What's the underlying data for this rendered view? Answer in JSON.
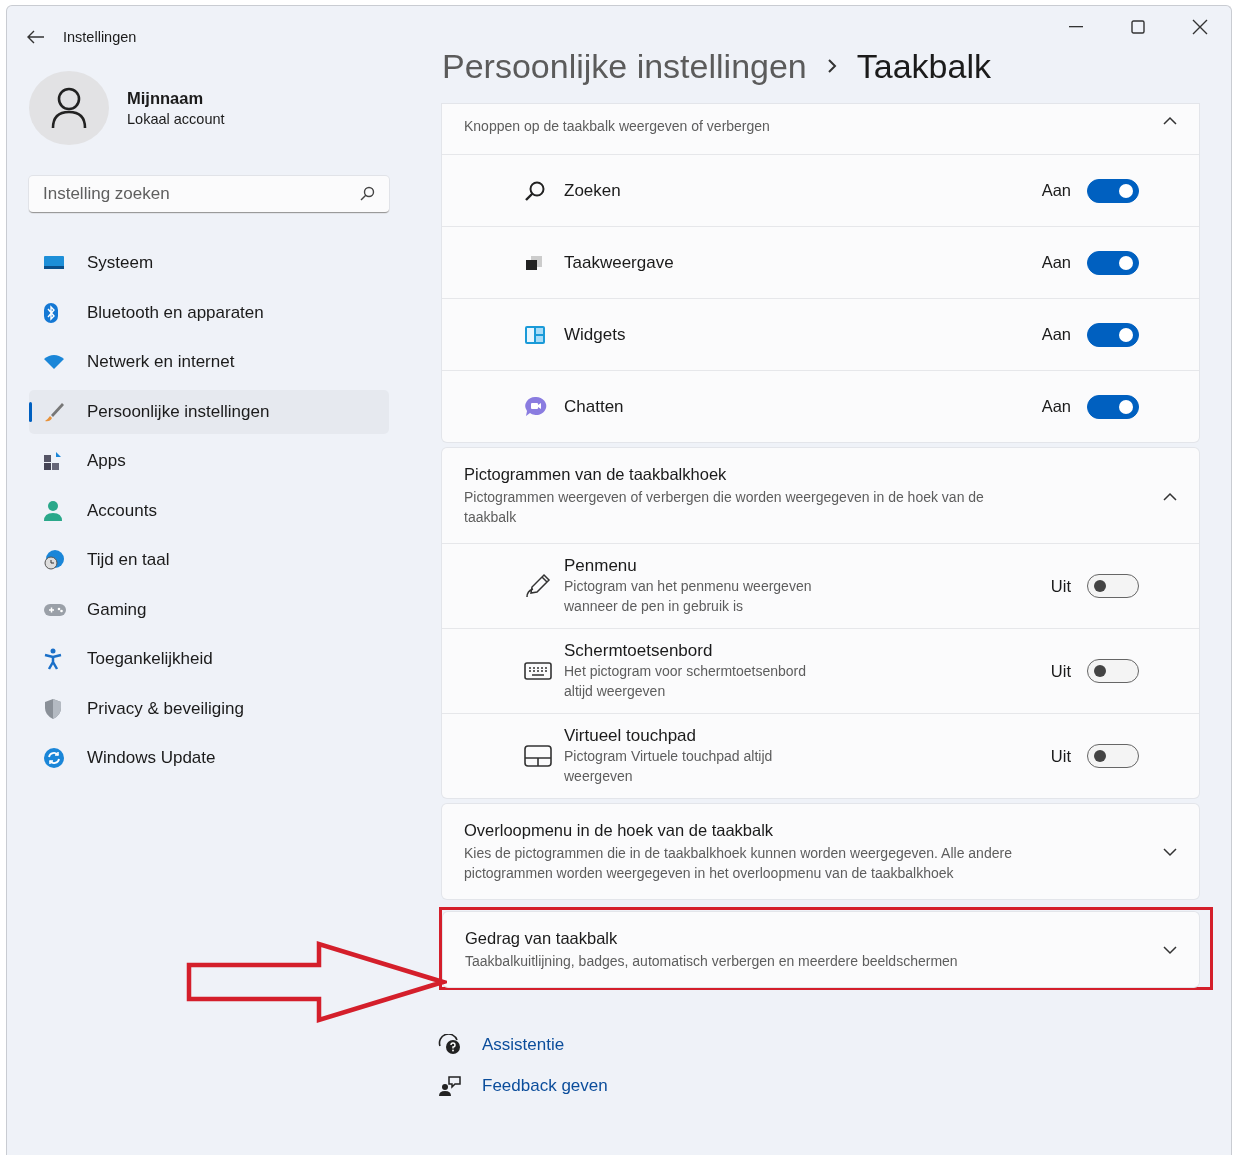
{
  "window": {
    "title": "Instellingen"
  },
  "account": {
    "name": "Mijnnaam",
    "type": "Lokaal account"
  },
  "search": {
    "placeholder": "Instelling zoeken"
  },
  "sidebar": {
    "items": [
      {
        "label": "Systeem",
        "kind": "system",
        "selected": false
      },
      {
        "label": "Bluetooth en apparaten",
        "kind": "bluetooth",
        "selected": false
      },
      {
        "label": "Netwerk en internet",
        "kind": "network",
        "selected": false
      },
      {
        "label": "Persoonlijke instellingen",
        "kind": "personalize",
        "selected": true
      },
      {
        "label": "Apps",
        "kind": "apps",
        "selected": false
      },
      {
        "label": "Accounts",
        "kind": "accounts",
        "selected": false
      },
      {
        "label": "Tijd en taal",
        "kind": "time",
        "selected": false
      },
      {
        "label": "Gaming",
        "kind": "gaming",
        "selected": false
      },
      {
        "label": "Toegankelijkheid",
        "kind": "accessibility",
        "selected": false
      },
      {
        "label": "Privacy & beveiliging",
        "kind": "privacy",
        "selected": false
      },
      {
        "label": "Windows Update",
        "kind": "update",
        "selected": false
      }
    ]
  },
  "breadcrumb": {
    "parent": "Persoonlijke instellingen",
    "current": "Taakbalk"
  },
  "sections": [
    {
      "description": "Knoppen op de taakbalk weergeven of verbergen",
      "expanded": true,
      "highlighted": false,
      "items": [
        {
          "label": "Zoeken",
          "kind": "search",
          "state": "Aan",
          "on": true
        },
        {
          "label": "Taakweergave",
          "kind": "taskview",
          "state": "Aan",
          "on": true
        },
        {
          "label": "Widgets",
          "kind": "widgets",
          "state": "Aan",
          "on": true
        },
        {
          "label": "Chatten",
          "kind": "chat",
          "state": "Aan",
          "on": true
        }
      ]
    },
    {
      "title": "Pictogrammen van de taakbalkhoek",
      "description": "Pictogrammen weergeven of verbergen die worden weergegeven in de hoek van de taakbalk",
      "expanded": true,
      "highlighted": false,
      "items": [
        {
          "label": "Penmenu",
          "description": "Pictogram van het penmenu weergeven wanneer de pen in gebruik is",
          "kind": "pen",
          "state": "Uit",
          "on": false
        },
        {
          "label": "Schermtoetsenbord",
          "description": "Het pictogram voor schermtoetsenbord altijd weergeven",
          "kind": "keyboard",
          "state": "Uit",
          "on": false
        },
        {
          "label": "Virtueel touchpad",
          "description": "Pictogram Virtuele touchpad altijd weergeven",
          "kind": "touchpad",
          "state": "Uit",
          "on": false
        }
      ]
    },
    {
      "title": "Overloopmenu in de hoek van de taakbalk",
      "description": "Kies de pictogrammen die in de taakbalkhoek kunnen worden weergegeven. Alle andere pictogrammen worden weergegeven in het overloopmenu van de taakbalkhoek",
      "expanded": false,
      "highlighted": false
    },
    {
      "title": "Gedrag van taakbalk",
      "description": "Taakbalkuitlijning, badges, automatisch verbergen en meerdere beeldschermen",
      "expanded": false,
      "highlighted": true
    }
  ],
  "links": [
    {
      "label": "Assistentie",
      "kind": "help"
    },
    {
      "label": "Feedback geven",
      "kind": "feedback"
    }
  ]
}
